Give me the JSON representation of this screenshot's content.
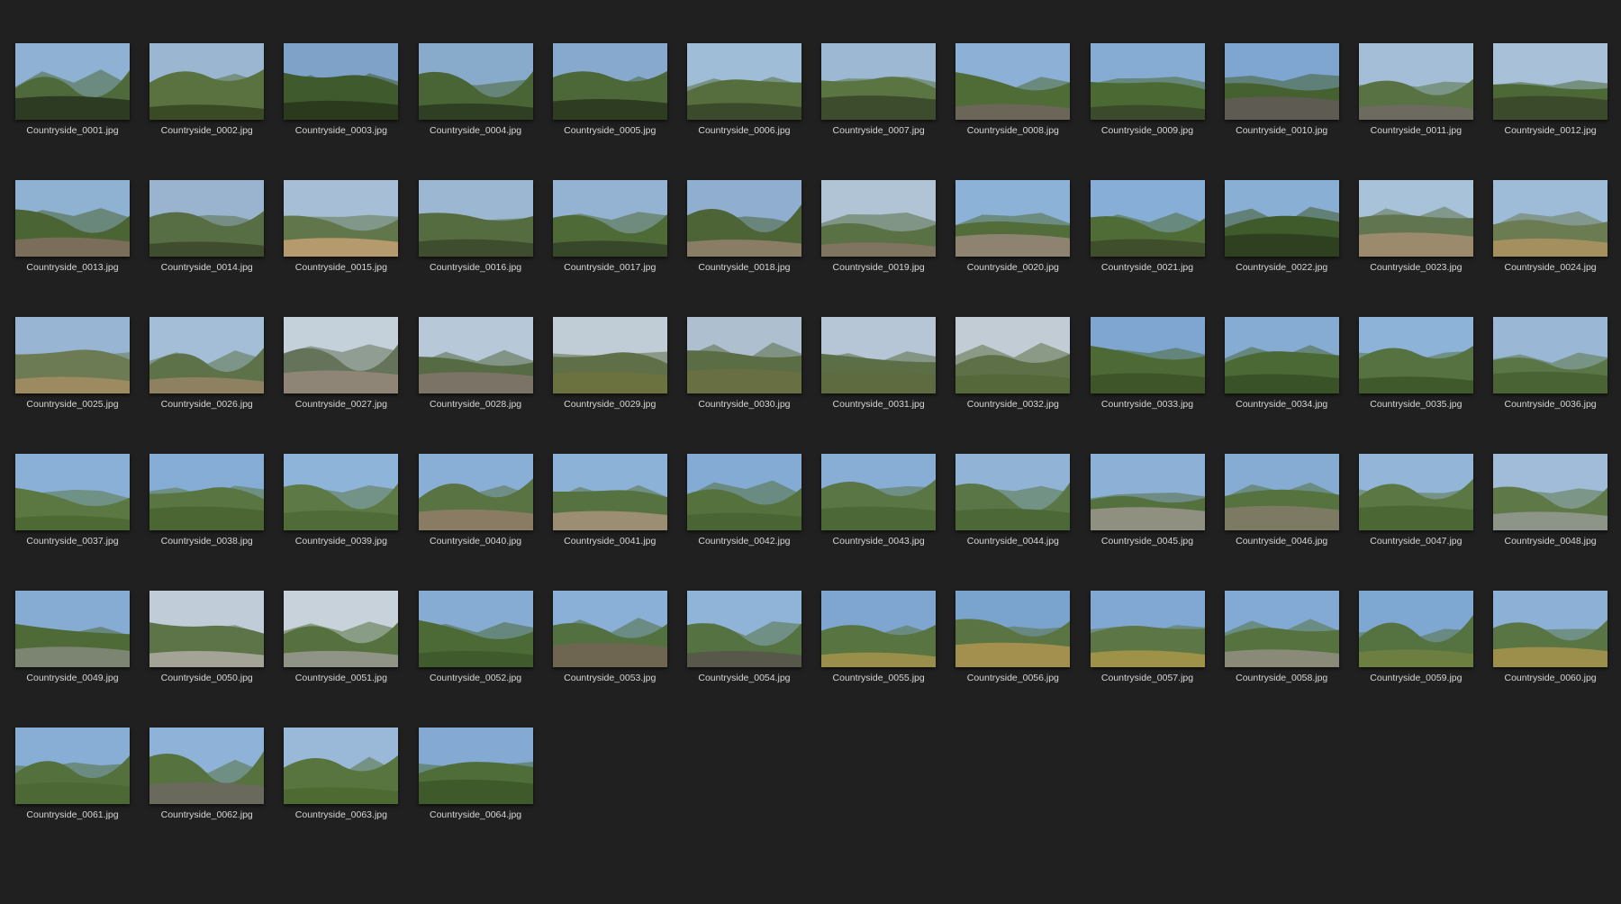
{
  "gallery": {
    "items": [
      {
        "name": "Countryside_0001.jpg",
        "sky": "#8fb2d4",
        "hill": "#4f6a3a",
        "ground": "#2d3b22"
      },
      {
        "name": "Countryside_0002.jpg",
        "sky": "#9ab6d0",
        "hill": "#5a7240",
        "ground": "#3a4a25"
      },
      {
        "name": "Countryside_0003.jpg",
        "sky": "#7fa3c8",
        "hill": "#3f5a2c",
        "ground": "#2b3a1c"
      },
      {
        "name": "Countryside_0004.jpg",
        "sky": "#88aacb",
        "hill": "#4a6535",
        "ground": "#2f3f24"
      },
      {
        "name": "Countryside_0005.jpg",
        "sky": "#86a9cd",
        "hill": "#4c6738",
        "ground": "#2e3d21"
      },
      {
        "name": "Countryside_0006.jpg",
        "sky": "#a0bdd8",
        "hill": "#566e3d",
        "ground": "#3b4a2a"
      },
      {
        "name": "Countryside_0007.jpg",
        "sky": "#9cb8d3",
        "hill": "#5a7442",
        "ground": "#3d4c2c"
      },
      {
        "name": "Countryside_0008.jpg",
        "sky": "#8cb0d6",
        "hill": "#4f6b36",
        "ground": "#6b6658"
      },
      {
        "name": "Countryside_0009.jpg",
        "sky": "#86acd4",
        "hill": "#4b6a33",
        "ground": "#3a4a2a"
      },
      {
        "name": "Countryside_0010.jpg",
        "sky": "#7ea6d0",
        "hill": "#44612f",
        "ground": "#5e5b52"
      },
      {
        "name": "Countryside_0011.jpg",
        "sky": "#a4bed8",
        "hill": "#587243",
        "ground": "#6d6a5f"
      },
      {
        "name": "Countryside_0012.jpg",
        "sky": "#a8c1d9",
        "hill": "#4d6837",
        "ground": "#3a4a2a"
      },
      {
        "name": "Countryside_0013.jpg",
        "sky": "#8fb1d2",
        "hill": "#4a6533",
        "ground": "#7a6e5a"
      },
      {
        "name": "Countryside_0014.jpg",
        "sky": "#9ab4cf",
        "hill": "#576e44",
        "ground": "#3f4d2e"
      },
      {
        "name": "Countryside_0015.jpg",
        "sky": "#a7bfd6",
        "hill": "#61764a",
        "ground": "#b59a6e"
      },
      {
        "name": "Countryside_0016.jpg",
        "sky": "#9cb7d1",
        "hill": "#546c40",
        "ground": "#3e4d2d"
      },
      {
        "name": "Countryside_0017.jpg",
        "sky": "#94b3d3",
        "hill": "#4e6a37",
        "ground": "#36472a"
      },
      {
        "name": "Countryside_0018.jpg",
        "sky": "#8faed0",
        "hill": "#4d6536",
        "ground": "#8a7d66"
      },
      {
        "name": "Countryside_0019.jpg",
        "sky": "#b0c4d6",
        "hill": "#5a7045",
        "ground": "#7e745f"
      },
      {
        "name": "Countryside_0020.jpg",
        "sky": "#8db2d8",
        "hill": "#526d3a",
        "ground": "#8d8370"
      },
      {
        "name": "Countryside_0021.jpg",
        "sky": "#86aed6",
        "hill": "#4f6c37",
        "ground": "#3f4f2c"
      },
      {
        "name": "Countryside_0022.jpg",
        "sky": "#8aafd4",
        "hill": "#3f5b2c",
        "ground": "#2f4021"
      },
      {
        "name": "Countryside_0023.jpg",
        "sky": "#a8c2da",
        "hill": "#617650",
        "ground": "#9b8a6b"
      },
      {
        "name": "Countryside_0024.jpg",
        "sky": "#9ebbd8",
        "hill": "#6c7c52",
        "ground": "#a48f5e"
      },
      {
        "name": "Countryside_0025.jpg",
        "sky": "#98b6d3",
        "hill": "#6c7b53",
        "ground": "#9d8a60"
      },
      {
        "name": "Countryside_0026.jpg",
        "sky": "#a4bed8",
        "hill": "#5d7248",
        "ground": "#8e8162"
      },
      {
        "name": "Countryside_0027.jpg",
        "sky": "#c4d0da",
        "hill": "#64735a",
        "ground": "#8f8576"
      },
      {
        "name": "Countryside_0028.jpg",
        "sky": "#b7c8d8",
        "hill": "#566a44",
        "ground": "#7a7366"
      },
      {
        "name": "Countryside_0029.jpg",
        "sky": "#c0ccd6",
        "hill": "#5f7048",
        "ground": "#6c7140"
      },
      {
        "name": "Countryside_0030.jpg",
        "sky": "#aebfd0",
        "hill": "#5a6d45",
        "ground": "#687043"
      },
      {
        "name": "Countryside_0031.jpg",
        "sky": "#b6c6d6",
        "hill": "#5b6e46",
        "ground": "#5e6a40"
      },
      {
        "name": "Countryside_0032.jpg",
        "sky": "#c2ccd4",
        "hill": "#5e7047",
        "ground": "#55683a"
      },
      {
        "name": "Countryside_0033.jpg",
        "sky": "#7fa6d0",
        "hill": "#4d6a36",
        "ground": "#3d5529"
      },
      {
        "name": "Countryside_0034.jpg",
        "sky": "#86acd4",
        "hill": "#4b6935",
        "ground": "#3a5228"
      },
      {
        "name": "Countryside_0035.jpg",
        "sky": "#8eb3d8",
        "hill": "#557240",
        "ground": "#3f592c"
      },
      {
        "name": "Countryside_0036.jpg",
        "sky": "#9ab8d6",
        "hill": "#5a7546",
        "ground": "#4a6334"
      },
      {
        "name": "Countryside_0037.jpg",
        "sky": "#8ab0d8",
        "hill": "#5b7843",
        "ground": "#4d6a35"
      },
      {
        "name": "Countryside_0038.jpg",
        "sky": "#86add6",
        "hill": "#597642",
        "ground": "#4b6633"
      },
      {
        "name": "Countryside_0039.jpg",
        "sky": "#8fb4da",
        "hill": "#5d7946",
        "ground": "#4f6b37"
      },
      {
        "name": "Countryside_0040.jpg",
        "sky": "#8aafd6",
        "hill": "#5a7343",
        "ground": "#8a7c62"
      },
      {
        "name": "Countryside_0041.jpg",
        "sky": "#8db2d8",
        "hill": "#577241",
        "ground": "#9c8e72"
      },
      {
        "name": "Countryside_0042.jpg",
        "sky": "#84abd4",
        "hill": "#55713e",
        "ground": "#4a6534"
      },
      {
        "name": "Countryside_0043.jpg",
        "sky": "#88aed6",
        "hill": "#5a7645",
        "ground": "#4c6836"
      },
      {
        "name": "Countryside_0044.jpg",
        "sky": "#90b3d6",
        "hill": "#5b7646",
        "ground": "#4d6837"
      },
      {
        "name": "Countryside_0045.jpg",
        "sky": "#8cb0d6",
        "hill": "#55703f",
        "ground": "#8f9080"
      },
      {
        "name": "Countryside_0046.jpg",
        "sky": "#86acd4",
        "hill": "#56723f",
        "ground": "#7c7a62"
      },
      {
        "name": "Countryside_0047.jpg",
        "sky": "#92b5d8",
        "hill": "#5b7744",
        "ground": "#4b6734"
      },
      {
        "name": "Countryside_0048.jpg",
        "sky": "#a0bcd8",
        "hill": "#5e7848",
        "ground": "#8d9488"
      },
      {
        "name": "Countryside_0049.jpg",
        "sky": "#86acd4",
        "hill": "#4e6b37",
        "ground": "#7c8472"
      },
      {
        "name": "Countryside_0050.jpg",
        "sky": "#c0ccd8",
        "hill": "#5d7348",
        "ground": "#a4a496"
      },
      {
        "name": "Countryside_0051.jpg",
        "sky": "#c8d2da",
        "hill": "#56703f",
        "ground": "#8f9486"
      },
      {
        "name": "Countryside_0052.jpg",
        "sky": "#86acd4",
        "hill": "#4c6a35",
        "ground": "#3f5a2c"
      },
      {
        "name": "Countryside_0053.jpg",
        "sky": "#8ab0d8",
        "hill": "#527040",
        "ground": "#6e6650"
      },
      {
        "name": "Countryside_0054.jpg",
        "sky": "#90b3d8",
        "hill": "#557242",
        "ground": "#58584a"
      },
      {
        "name": "Countryside_0055.jpg",
        "sky": "#7ea6d0",
        "hill": "#587441",
        "ground": "#9a8f4a"
      },
      {
        "name": "Countryside_0056.jpg",
        "sky": "#7aa3ce",
        "hill": "#5a7543",
        "ground": "#a3904e"
      },
      {
        "name": "Countryside_0057.jpg",
        "sky": "#80a8d2",
        "hill": "#5c7745",
        "ground": "#9d9248"
      },
      {
        "name": "Countryside_0058.jpg",
        "sky": "#82aad4",
        "hill": "#56723f",
        "ground": "#8a8a78"
      },
      {
        "name": "Countryside_0059.jpg",
        "sky": "#7ea7d2",
        "hill": "#557241",
        "ground": "#6c7f40"
      },
      {
        "name": "Countryside_0060.jpg",
        "sky": "#8cb0d6",
        "hill": "#5a7544",
        "ground": "#9c8f4c"
      },
      {
        "name": "Countryside_0061.jpg",
        "sky": "#88aed6",
        "hill": "#53703d",
        "ground": "#4b6835"
      },
      {
        "name": "Countryside_0062.jpg",
        "sky": "#8eb2d8",
        "hill": "#56733f",
        "ground": "#6a6a5c"
      },
      {
        "name": "Countryside_0063.jpg",
        "sky": "#9ab8d8",
        "hill": "#58743f",
        "ground": "#4d6a32"
      },
      {
        "name": "Countryside_0064.jpg",
        "sky": "#84aad4",
        "hill": "#4f6d38",
        "ground": "#3e5a2a"
      }
    ]
  }
}
